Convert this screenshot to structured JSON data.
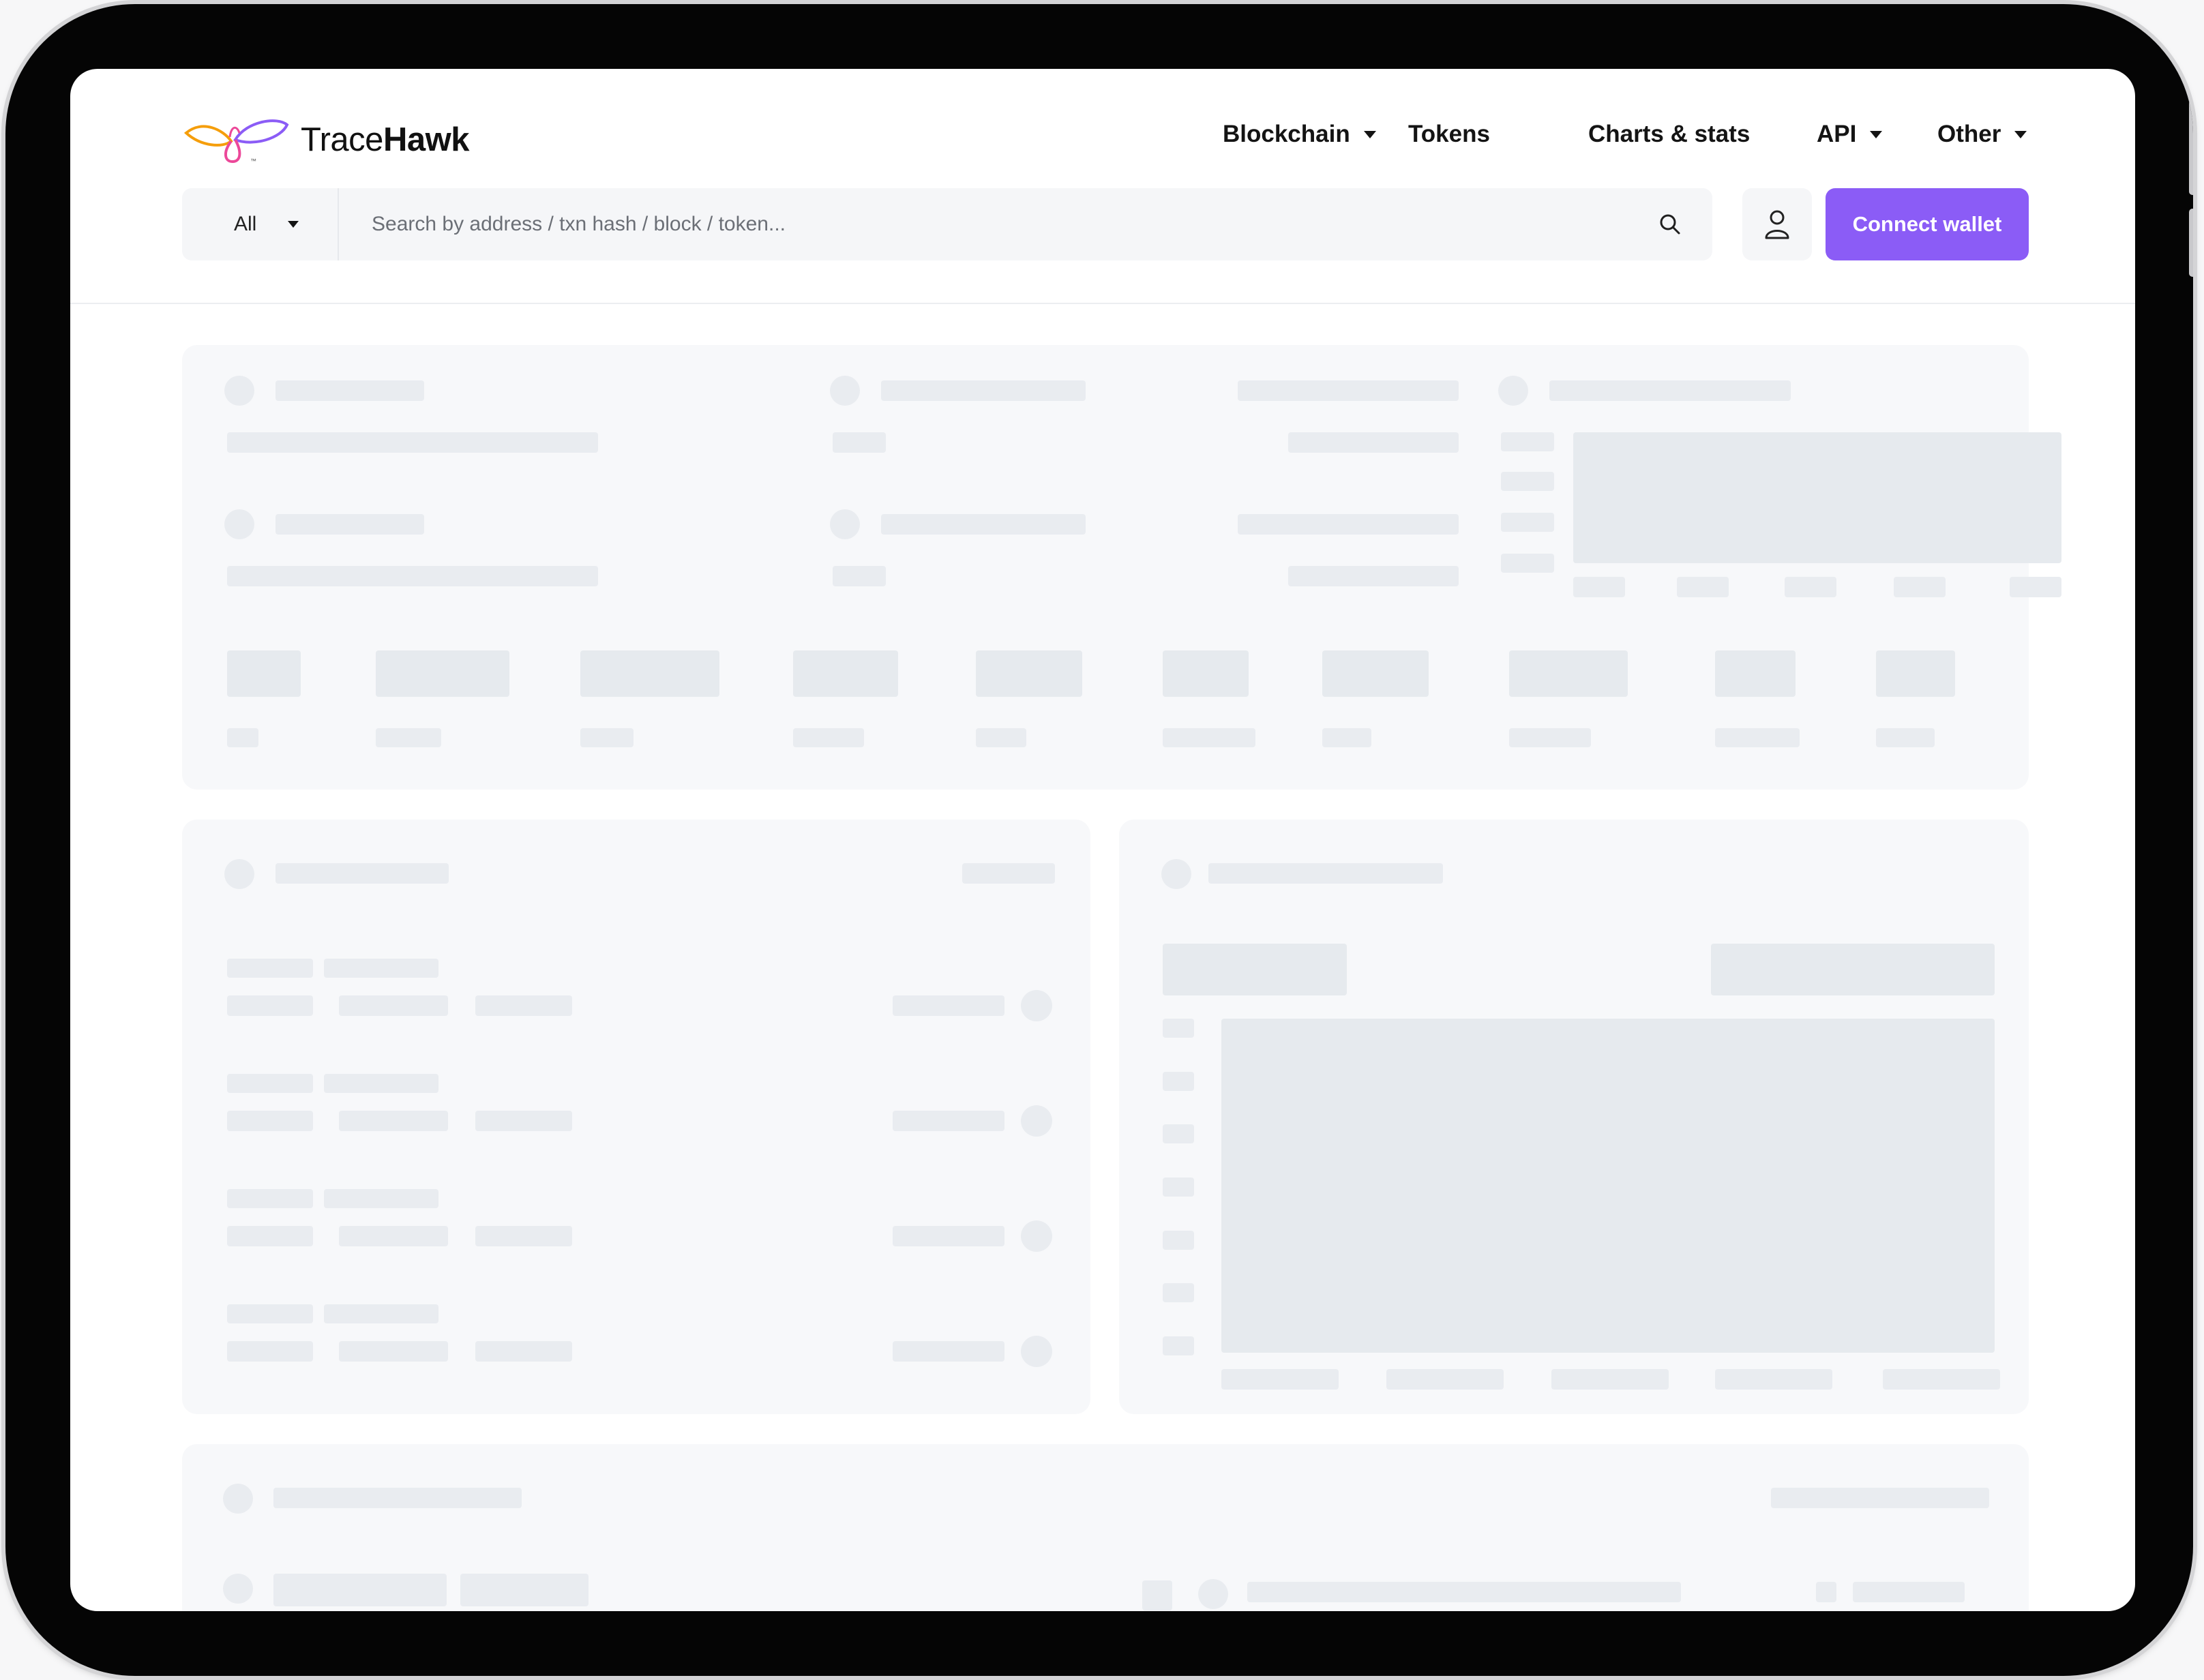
{
  "brand": {
    "name_light": "Trace",
    "name_bold": "Hawk",
    "logo_colors": [
      "#f59e0b",
      "#ec4899",
      "#8b5cf6"
    ]
  },
  "nav": {
    "items": [
      {
        "label": "Blockchain",
        "has_dropdown": true
      },
      {
        "label": "Tokens",
        "has_dropdown": false
      },
      {
        "label": "Charts & stats",
        "has_dropdown": false
      },
      {
        "label": "API",
        "has_dropdown": true
      },
      {
        "label": "Other",
        "has_dropdown": true
      }
    ]
  },
  "search": {
    "filter_value": "All",
    "placeholder": "Search by address / txn hash / block / token..."
  },
  "header": {
    "connect_label": "Connect wallet"
  },
  "colors": {
    "accent": "#8b5cf6",
    "skeleton": "#e9ecf0",
    "card_bg": "#f7f8fa"
  },
  "icons": [
    "search-icon",
    "user-icon",
    "chevron-down-icon",
    "tracehawk-logo-icon"
  ],
  "state": "loading-skeleton"
}
